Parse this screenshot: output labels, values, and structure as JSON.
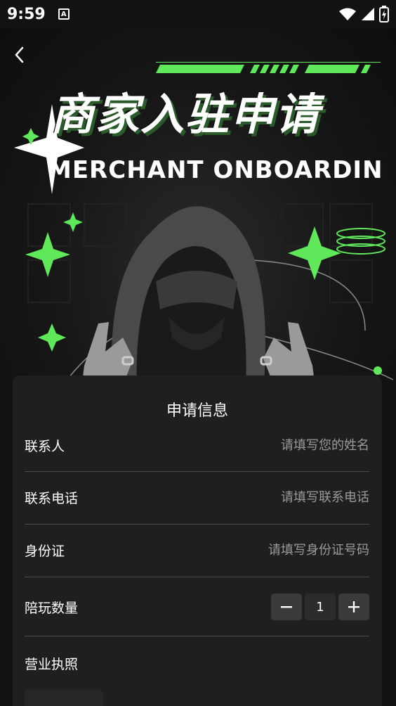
{
  "status_bar": {
    "time": "9:59",
    "notification_badge": "A"
  },
  "hero": {
    "title": "商家入驻申请",
    "subtitle": "MERCHANT ONBOARDIN",
    "accent_color": "#5ee85a"
  },
  "form": {
    "title": "申请信息",
    "fields": [
      {
        "label": "联系人",
        "placeholder": "请填写您的姓名",
        "value": ""
      },
      {
        "label": "联系电话",
        "placeholder": "请填写联系电话",
        "value": ""
      },
      {
        "label": "身份证",
        "placeholder": "请填写身份证号码",
        "value": ""
      }
    ],
    "quantity": {
      "label": "陪玩数量",
      "value": "1",
      "minus": "−",
      "plus": "+"
    },
    "license": {
      "label": "营业执照"
    }
  },
  "colors": {
    "background": "#121212",
    "card": "#1f1f1f",
    "divider": "#4a4a4a",
    "placeholder": "#9a9a9a"
  }
}
